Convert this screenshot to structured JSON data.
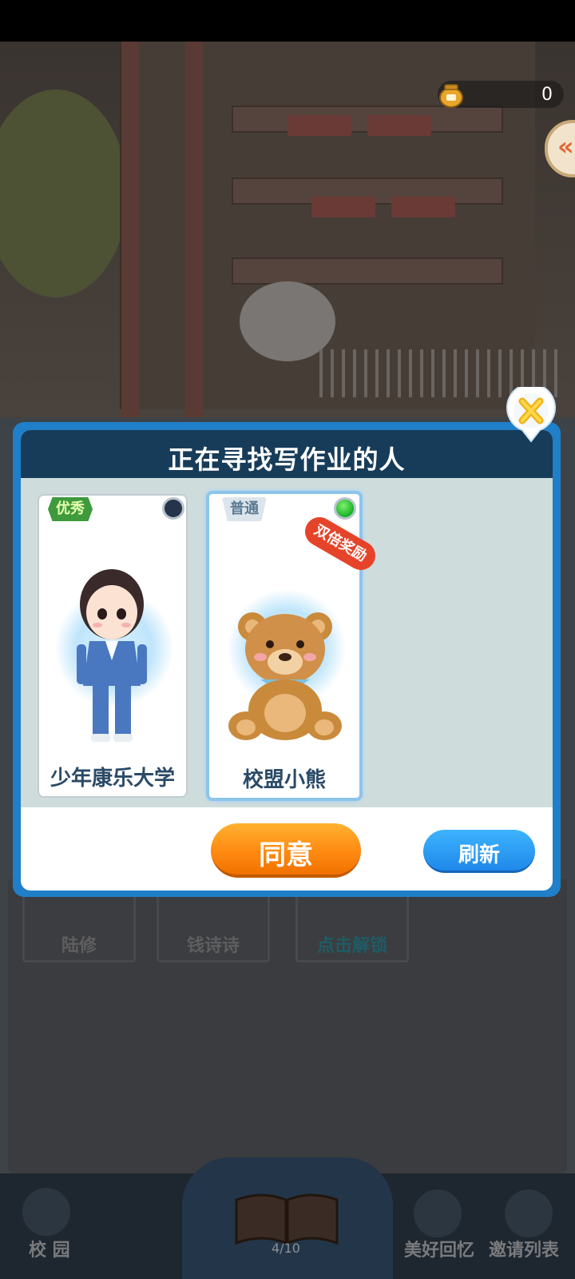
{
  "header": {
    "coin_count": "0"
  },
  "modal": {
    "title": "正在寻找写作业的人",
    "candidates": [
      {
        "name": "少年康乐大学",
        "tier": "优秀",
        "selected": false,
        "bonus": ""
      },
      {
        "name": "校盟小熊",
        "tier": "普通",
        "selected": true,
        "bonus": "双倍奖励"
      }
    ],
    "agree_label": "同意",
    "refresh_label": "刷新"
  },
  "background_cards": [
    {
      "name": "陆修"
    },
    {
      "name": "钱诗诗"
    },
    {
      "name": "点击解锁"
    }
  ],
  "bottom_nav": {
    "campus_label": "校 园",
    "page_indicator": "4/10",
    "memories_label": "美好回忆",
    "invite_label": "邀请列表"
  },
  "colors": {
    "modal_frame": "#1f7fc8",
    "header_bg": "#173c5a",
    "agree_orange": "#ff8a12",
    "refresh_blue": "#1f88ea",
    "selected_green": "#18b02a"
  }
}
